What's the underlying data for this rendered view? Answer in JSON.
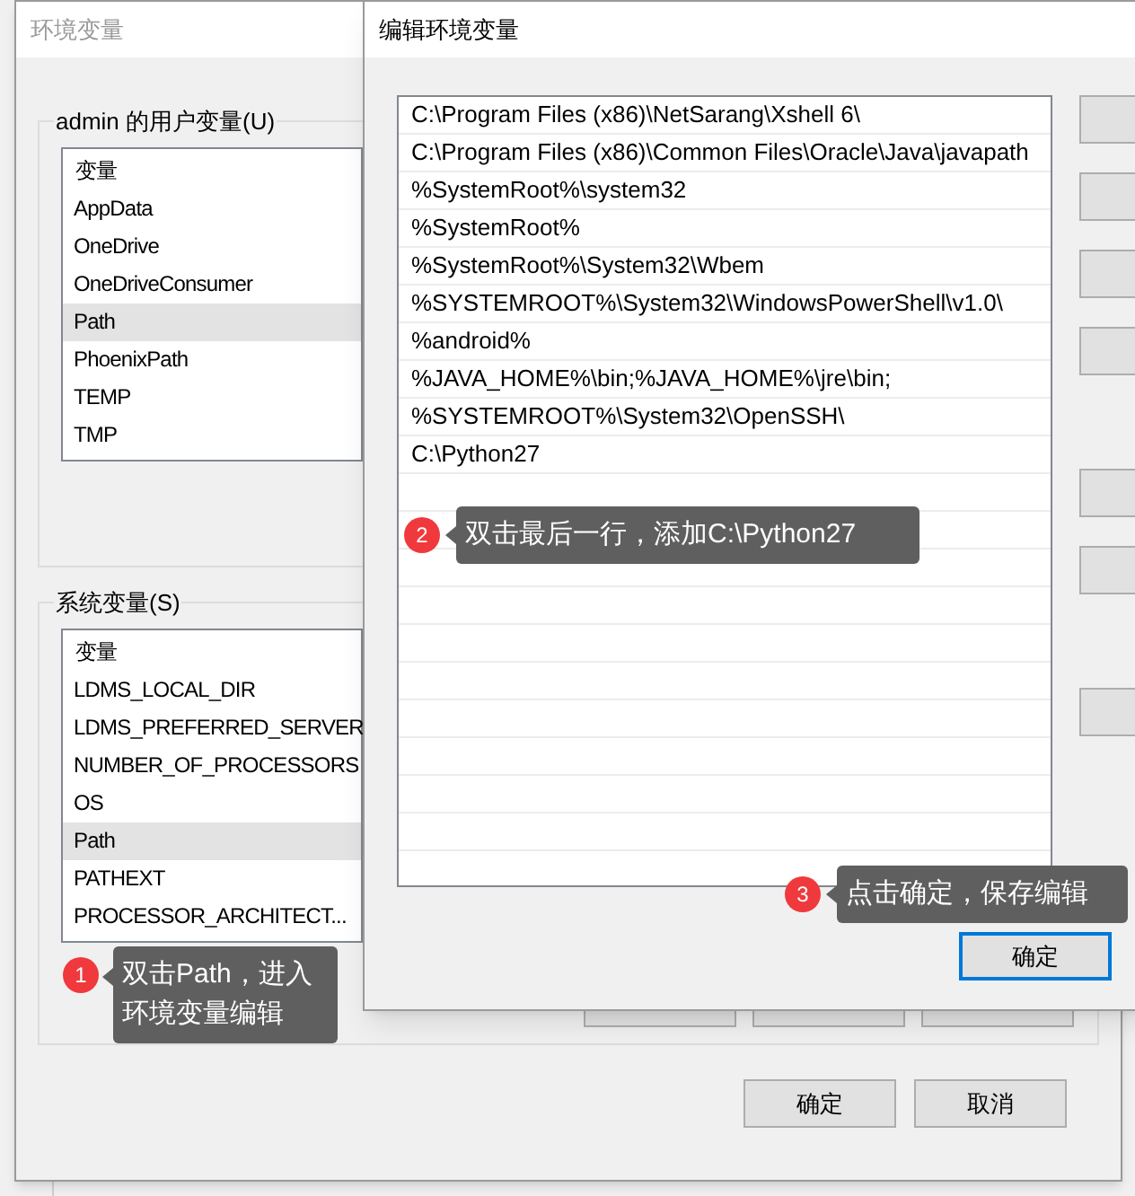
{
  "env_window": {
    "title": "环境变量",
    "user_variables": {
      "label": "admin 的用户变量(U)",
      "header": "变量",
      "rows": [
        {
          "name": "AppData",
          "selected": false
        },
        {
          "name": "OneDrive",
          "selected": false
        },
        {
          "name": "OneDriveConsumer",
          "selected": false
        },
        {
          "name": "Path",
          "selected": true
        },
        {
          "name": "PhoenixPath",
          "selected": false
        },
        {
          "name": "TEMP",
          "selected": false
        },
        {
          "name": "TMP",
          "selected": false
        }
      ]
    },
    "system_variables": {
      "label": "系统变量(S)",
      "header": "变量",
      "rows": [
        {
          "name": "LDMS_LOCAL_DIR",
          "selected": false
        },
        {
          "name": "LDMS_PREFERRED_SERVER",
          "selected": false
        },
        {
          "name": "NUMBER_OF_PROCESSORS",
          "selected": false
        },
        {
          "name": "OS",
          "selected": false
        },
        {
          "name": "Path",
          "selected": true
        },
        {
          "name": "PATHEXT",
          "selected": false
        },
        {
          "name": "PROCESSOR_ARCHITECT...",
          "selected": false
        }
      ]
    },
    "buttons": [
      "确定",
      "取消"
    ]
  },
  "edit_dialog": {
    "title": "编辑环境变量",
    "entries": [
      "C:\\Program Files (x86)\\NetSarang\\Xshell 6\\",
      "C:\\Program Files (x86)\\Common Files\\Oracle\\Java\\javapath",
      "%SystemRoot%\\system32",
      "%SystemRoot%",
      "%SystemRoot%\\System32\\Wbem",
      "%SYSTEMROOT%\\System32\\WindowsPowerShell\\v1.0\\",
      "%android%",
      "%JAVA_HOME%\\bin;%JAVA_HOME%\\jre\\bin;",
      "%SYSTEMROOT%\\System32\\OpenSSH\\",
      "C:\\Python27"
    ],
    "ok_button": "确定"
  },
  "callouts": [
    {
      "number": "1",
      "text": "双击Path，进入环境变量编辑"
    },
    {
      "number": "2",
      "text": "双击最后一行，添加C:\\Python27"
    },
    {
      "number": "3",
      "text": "点击确定，保存编辑"
    }
  ]
}
